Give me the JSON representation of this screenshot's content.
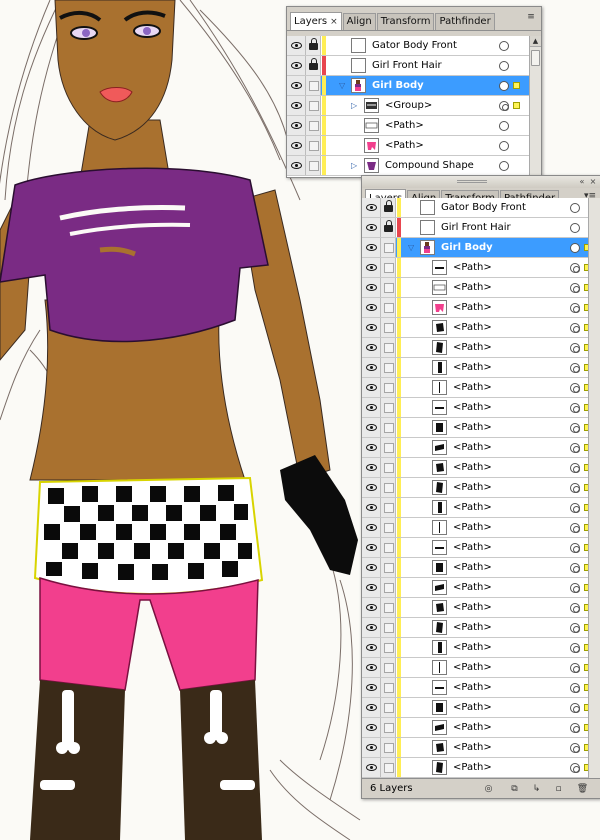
{
  "colors": {
    "selection_blue": "#3c9cff",
    "layer_yellow": "#ffee55",
    "layer_red": "#e8464f",
    "skin": "#a9712f",
    "top_purple": "#7a2b84",
    "shorts_pink": "#f23f8d"
  },
  "panel_top": {
    "tabs": [
      {
        "label": "Layers",
        "close": "×",
        "active": true
      },
      {
        "label": "Align",
        "active": false
      },
      {
        "label": "Transform",
        "active": false
      },
      {
        "label": "Pathfinder",
        "active": false
      }
    ],
    "menu_icon": "panel-menu-icon",
    "layers": [
      {
        "name": "Gator Body Front",
        "locked": true,
        "color": "#ffee55",
        "expander": false,
        "indent": 0,
        "selected": false
      },
      {
        "name": "Girl Front Hair",
        "locked": true,
        "color": "#e8464f",
        "expander": false,
        "indent": 0,
        "selected": false
      },
      {
        "name": "Girl Body",
        "locked": false,
        "color": "#ffee55",
        "expander": true,
        "expanded": true,
        "indent": 0,
        "selected": true
      },
      {
        "name": "<Group>",
        "locked": false,
        "color": "#ffee55",
        "expander": true,
        "expanded": false,
        "indent": 1,
        "selected": false,
        "double": true
      },
      {
        "name": "<Path>",
        "locked": false,
        "color": "#ffee55",
        "expander": false,
        "indent": 1,
        "selected": false
      },
      {
        "name": "<Path>",
        "locked": false,
        "color": "#ffee55",
        "expander": false,
        "indent": 1,
        "selected": false
      },
      {
        "name": "Compound Shape",
        "locked": false,
        "color": "#ffee55",
        "expander": true,
        "expanded": false,
        "indent": 1,
        "selected": false
      }
    ]
  },
  "panel_main": {
    "tabs": [
      {
        "label": "Layers",
        "active": true
      },
      {
        "label": "Align",
        "active": false
      },
      {
        "label": "Transform",
        "active": false
      },
      {
        "label": "Pathfinder",
        "active": false
      }
    ],
    "menu_icon": "panel-menu-icon",
    "layers_count_label": "6 Layers",
    "layers": [
      {
        "name": "Gator Body Front",
        "locked": true,
        "color": "#ffee55",
        "expander": false,
        "indent": 0,
        "selected": false
      },
      {
        "name": "Girl Front Hair",
        "locked": true,
        "color": "#e8464f",
        "expander": false,
        "indent": 0,
        "selected": false
      },
      {
        "name": "Girl Body",
        "locked": false,
        "color": "#ffee55",
        "expander": true,
        "expanded": true,
        "indent": 0,
        "selected": true
      },
      {
        "name": "<Path>",
        "indent": 1,
        "double": true
      },
      {
        "name": "<Path>",
        "indent": 1,
        "double": true
      },
      {
        "name": "<Path>",
        "indent": 1,
        "double": true
      },
      {
        "name": "<Path>",
        "indent": 1,
        "double": true
      },
      {
        "name": "<Path>",
        "indent": 1,
        "double": true
      },
      {
        "name": "<Path>",
        "indent": 1,
        "double": true
      },
      {
        "name": "<Path>",
        "indent": 1,
        "double": true
      },
      {
        "name": "<Path>",
        "indent": 1,
        "double": true
      },
      {
        "name": "<Path>",
        "indent": 1,
        "double": true
      },
      {
        "name": "<Path>",
        "indent": 1,
        "double": true
      },
      {
        "name": "<Path>",
        "indent": 1,
        "double": true
      },
      {
        "name": "<Path>",
        "indent": 1,
        "double": true
      },
      {
        "name": "<Path>",
        "indent": 1,
        "double": true
      },
      {
        "name": "<Path>",
        "indent": 1,
        "double": true
      },
      {
        "name": "<Path>",
        "indent": 1,
        "double": true
      },
      {
        "name": "<Path>",
        "indent": 1,
        "double": true
      },
      {
        "name": "<Path>",
        "indent": 1,
        "double": true
      },
      {
        "name": "<Path>",
        "indent": 1,
        "double": true
      },
      {
        "name": "<Path>",
        "indent": 1,
        "double": true
      },
      {
        "name": "<Path>",
        "indent": 1,
        "double": true
      },
      {
        "name": "<Path>",
        "indent": 1,
        "double": true
      },
      {
        "name": "<Path>",
        "indent": 1,
        "double": true
      },
      {
        "name": "<Path>",
        "indent": 1,
        "double": true
      },
      {
        "name": "<Path>",
        "indent": 1,
        "double": true
      },
      {
        "name": "<Path>",
        "indent": 1,
        "double": true
      },
      {
        "name": "<Path>",
        "indent": 1,
        "double": true
      }
    ],
    "footer_icons": [
      "locate-object-icon",
      "make-clipping-mask-icon",
      "new-sublayer-icon",
      "new-layer-icon",
      "trash-icon"
    ]
  }
}
